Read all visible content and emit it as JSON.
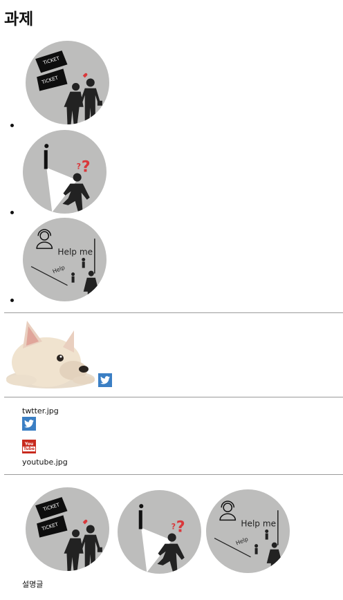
{
  "page": {
    "title": "과제"
  },
  "illustrations": {
    "ticket_line1": "TiCKET",
    "ticket_line2": "TiCKET",
    "help_me": "Help me",
    "help": "Help"
  },
  "media_list": {
    "twitter_caption": "twtter.jpg",
    "youtube_caption": "youtube.jpg",
    "youtube_badge_top": "You",
    "youtube_badge_bottom": "Tube"
  },
  "gallery": {
    "caption": "설명글"
  },
  "colors": {
    "circle_bg": "#bdbdbc",
    "twitter_blue": "#3b7fc4",
    "youtube_red": "#c82a1e",
    "accent_red": "#d9383b"
  }
}
